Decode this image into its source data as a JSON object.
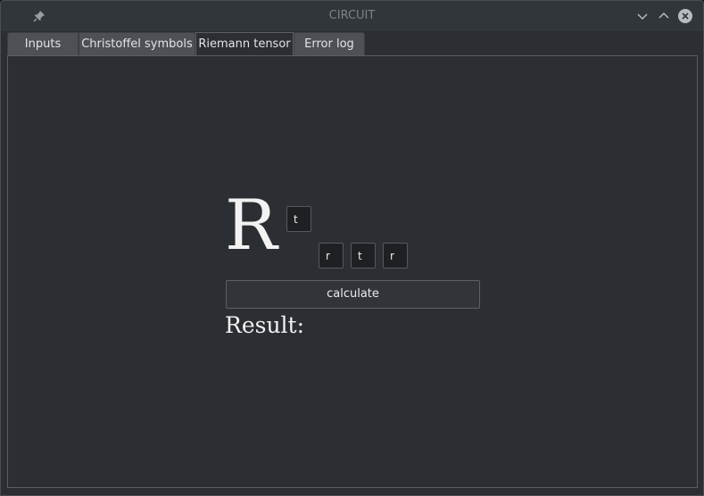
{
  "window": {
    "title": "CIRCUIT"
  },
  "titlebar": {
    "pin_icon": "pin-icon",
    "minimize_icon": "chevron-down-icon",
    "maximize_icon": "chevron-up-icon",
    "close_icon": "close-circle-icon"
  },
  "tabs": [
    {
      "label": "Inputs",
      "active": false
    },
    {
      "label": "Christoffel symbols",
      "active": false
    },
    {
      "label": "Riemann tensor",
      "active": true
    },
    {
      "label": "Error log",
      "active": false
    }
  ],
  "riemann": {
    "symbol": "R",
    "upper_index": "t",
    "lower_indices": [
      "r",
      "t",
      "r"
    ],
    "calculate_label": "calculate",
    "result_label": "Result:"
  },
  "colors": {
    "background": "#2b2e32",
    "titlebar": "#31363b",
    "tab_inactive": "#4d5055",
    "text": "#ececec"
  }
}
